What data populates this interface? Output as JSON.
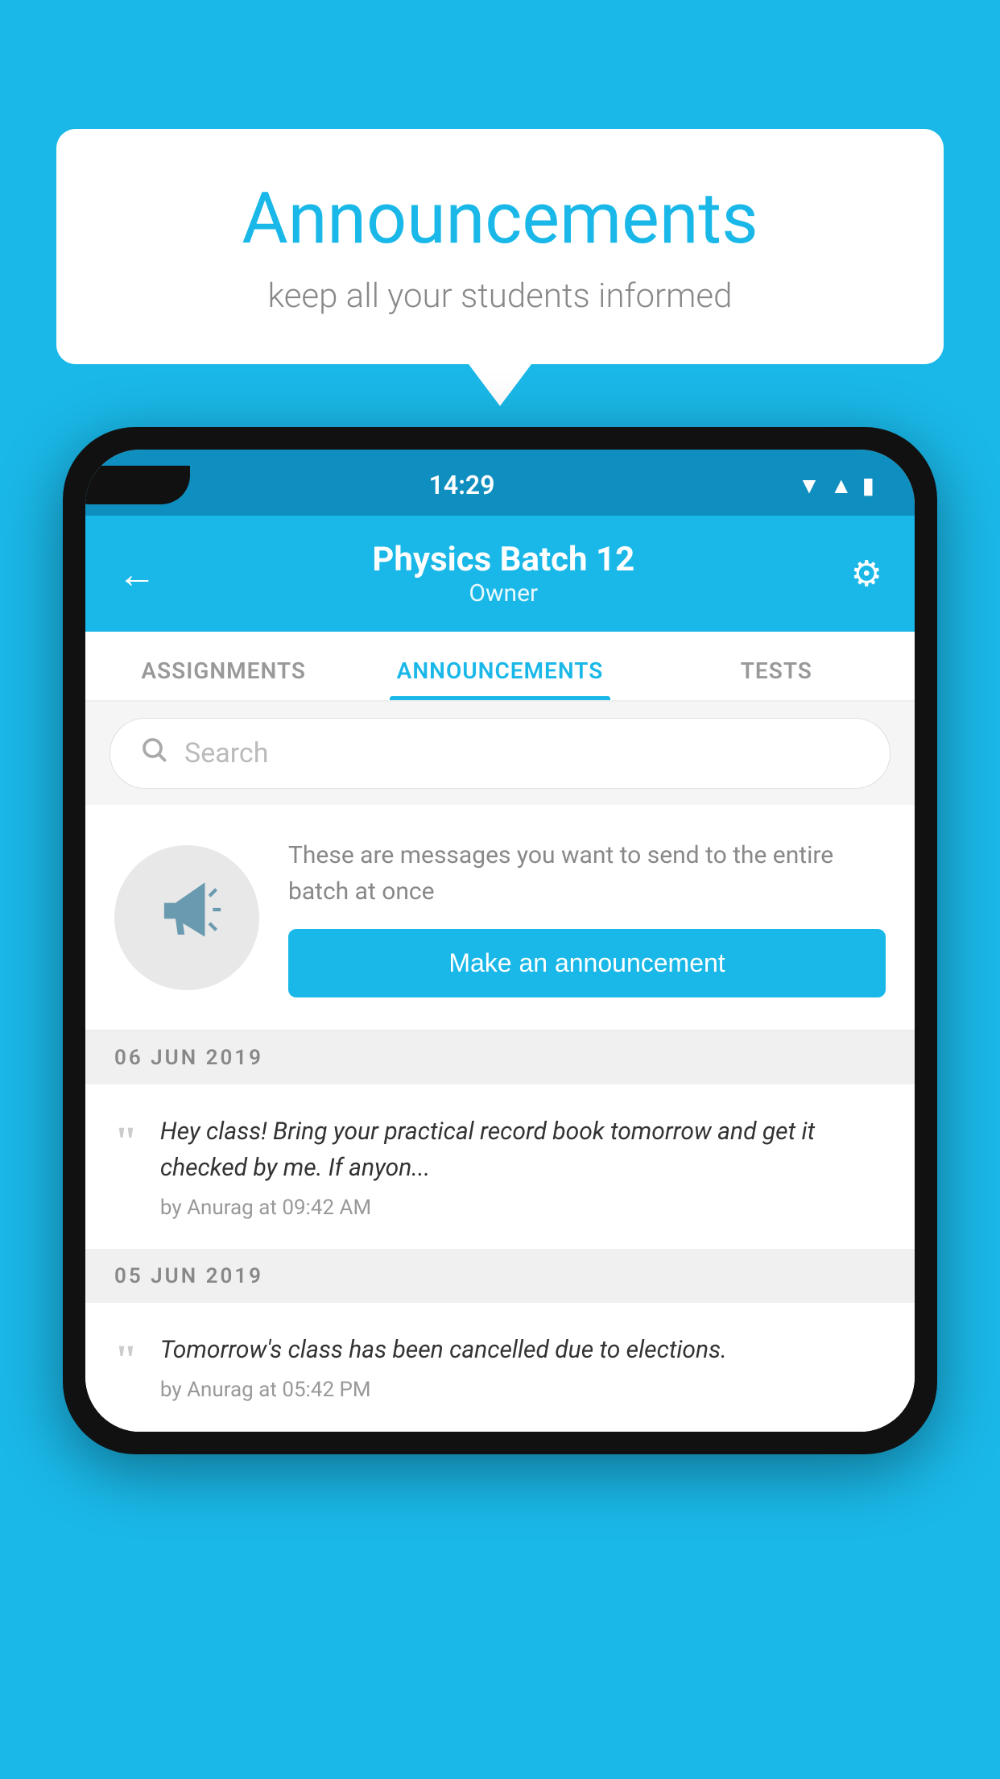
{
  "background_color": "#1ab8e8",
  "speech_bubble": {
    "title": "Announcements",
    "subtitle": "keep all your students informed"
  },
  "phone": {
    "status_bar": {
      "time": "14:29",
      "icons": [
        "wifi",
        "signal",
        "battery"
      ]
    },
    "app_bar": {
      "back_label": "←",
      "title": "Physics Batch 12",
      "subtitle": "Owner",
      "gear_label": "⚙"
    },
    "tabs": [
      {
        "label": "ASSIGNMENTS",
        "active": false
      },
      {
        "label": "ANNOUNCEMENTS",
        "active": true
      },
      {
        "label": "TESTS",
        "active": false
      }
    ],
    "search": {
      "placeholder": "Search"
    },
    "announcement_prompt": {
      "description_text": "These are messages you want to send to the entire batch at once",
      "button_label": "Make an announcement"
    },
    "date_groups": [
      {
        "date": "06  JUN  2019",
        "announcements": [
          {
            "text": "Hey class! Bring your practical record book tomorrow and get it checked by me. If anyon...",
            "meta": "by Anurag at 09:42 AM"
          }
        ]
      },
      {
        "date": "05  JUN  2019",
        "announcements": [
          {
            "text": "Tomorrow's class has been cancelled due to elections.",
            "meta": "by Anurag at 05:42 PM"
          }
        ]
      }
    ]
  }
}
